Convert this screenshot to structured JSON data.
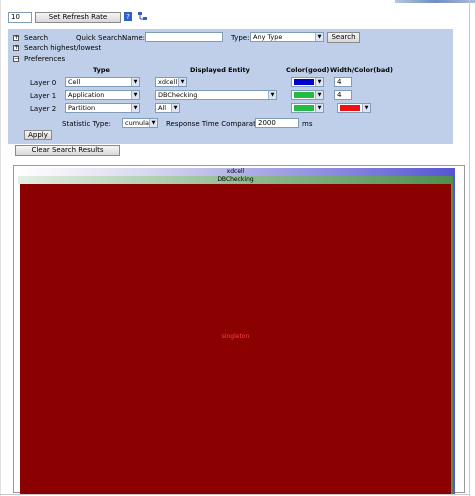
{
  "toolbar": {
    "refresh_value": "10",
    "set_refresh_label": "Set Refresh Rate"
  },
  "search": {
    "search_label": "Search",
    "quick_search_label": "Quick Search:",
    "name_label": "Name:",
    "name_value": "",
    "type_label": "Type:",
    "type_value": "Any Type",
    "search_button": "Search",
    "highest_lowest_label": "Search highest/lowest",
    "preferences_label": "Preferences"
  },
  "preferences": {
    "headers": {
      "type": "Type",
      "displayed_entity": "Displayed Entity",
      "color_good": "Color(good)",
      "width_color_bad": "Width/Color(bad)"
    },
    "layers": [
      {
        "label": "Layer 0",
        "type": "Cell",
        "entity": "xdcell",
        "good_color": "#0000cc",
        "width": "4"
      },
      {
        "label": "Layer 1",
        "type": "Application",
        "entity": "DBChecking",
        "good_color": "#22bb44",
        "width": "4"
      },
      {
        "label": "Layer 2",
        "type": "Partition",
        "entity": "All",
        "good_color": "#22bb44",
        "bad_color": "#ee1111"
      }
    ],
    "statistic_type_label": "Statistic Type:",
    "statistic_type_value": "cumulative",
    "comparator_label": "Response Time Comparator",
    "comparator_value": "2000",
    "comparator_unit": "ms",
    "apply_label": "Apply"
  },
  "clear_results_label": "Clear Search Results",
  "treemap": {
    "root_label": "xdcell",
    "app_label": "DBChecking",
    "leaf_label": "singleton",
    "leaf_color": "#8b0000"
  }
}
